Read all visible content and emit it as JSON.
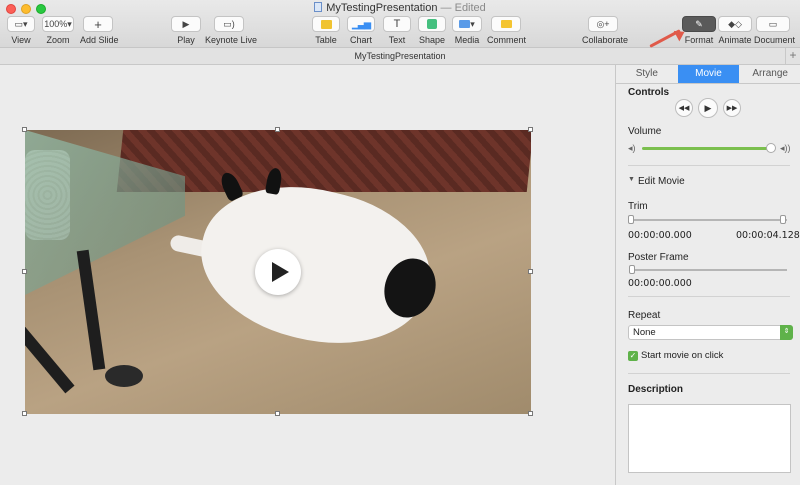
{
  "window": {
    "title": "MyTestingPresentation",
    "status": "— Edited"
  },
  "toolbar": {
    "view": {
      "label": "View",
      "icon": "view-icon"
    },
    "zoom": {
      "label": "Zoom",
      "value": "100%"
    },
    "add_slide": {
      "label": "Add Slide",
      "icon": "plus-icon"
    },
    "play": {
      "label": "Play",
      "icon": "play-icon"
    },
    "keynote_live": {
      "label": "Keynote Live",
      "icon": "live-icon"
    },
    "table": {
      "label": "Table",
      "icon": "table-icon"
    },
    "chart": {
      "label": "Chart",
      "icon": "chart-icon"
    },
    "text": {
      "label": "Text",
      "icon": "text-icon"
    },
    "shape": {
      "label": "Shape",
      "icon": "shape-icon"
    },
    "media": {
      "label": "Media",
      "icon": "media-icon"
    },
    "comment": {
      "label": "Comment",
      "icon": "comment-icon"
    },
    "collaborate": {
      "label": "Collaborate",
      "icon": "collaborate-icon"
    },
    "format": {
      "label": "Format",
      "icon": "paintbrush-icon"
    },
    "animate": {
      "label": "Animate",
      "icon": "animate-icon"
    },
    "document": {
      "label": "Document",
      "icon": "document-icon"
    }
  },
  "docbar": {
    "title": "MyTestingPresentation"
  },
  "sidebar": {
    "tabs": [
      "Style",
      "Movie",
      "Arrange"
    ],
    "active_tab": "Movie",
    "controls": {
      "heading": "Controls"
    },
    "volume": {
      "label": "Volume",
      "level": 0.95
    },
    "edit_movie": {
      "heading": "Edit Movie"
    },
    "trim": {
      "label": "Trim",
      "start": "00:00:00.000",
      "end": "00:00:04.128"
    },
    "poster_frame": {
      "label": "Poster Frame",
      "value": "00:00:00.000"
    },
    "repeat": {
      "label": "Repeat",
      "selected": "None"
    },
    "start_on_click": {
      "label": "Start movie on click",
      "checked": true
    },
    "description": {
      "heading": "Description",
      "value": ""
    }
  },
  "colors": {
    "accent": "#3a8ff3",
    "green": "#5fb24a",
    "annotation": "#e05a4a"
  }
}
